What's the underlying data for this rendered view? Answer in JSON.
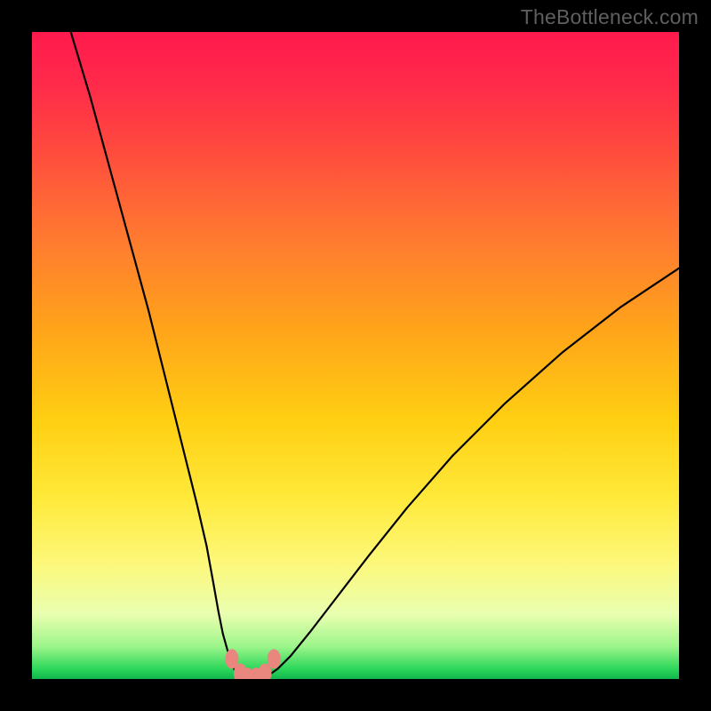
{
  "watermark": {
    "text": "TheBottleneck.com"
  },
  "chart_data": {
    "type": "line",
    "title": "",
    "xlabel": "",
    "ylabel": "",
    "xlim": [
      0,
      100
    ],
    "ylim": [
      0,
      100
    ],
    "grid": false,
    "legend": false,
    "series": [
      {
        "name": "bottleneck-curve",
        "x": [
          6,
          9,
          12,
          15,
          18,
          20,
          22,
          24,
          25.5,
          27,
          28,
          28.8,
          29.5,
          30.2,
          30.8,
          31.3,
          31.8
        ],
        "values": [
          100,
          90,
          79,
          68,
          57,
          49,
          41,
          33,
          27,
          20.5,
          15,
          10.5,
          7,
          4.5,
          2.7,
          1.4,
          0.6
        ]
      },
      {
        "name": "bottleneck-curve-min",
        "x": [
          31.8,
          32.3,
          32.9,
          33.6,
          34.4,
          35.4,
          36.6
        ],
        "values": [
          0.6,
          0.25,
          0.1,
          0.05,
          0.1,
          0.25,
          0.6
        ]
      },
      {
        "name": "bottleneck-curve-right",
        "x": [
          36.6,
          38,
          40,
          43,
          47,
          52,
          58,
          65,
          73,
          82,
          91,
          100
        ],
        "values": [
          0.6,
          1.6,
          3.6,
          7.3,
          12.5,
          19,
          26.5,
          34.5,
          42.5,
          50.5,
          57.5,
          63.5
        ]
      }
    ],
    "markers": {
      "name": "highlight-points",
      "x": [
        30.9,
        32.2,
        33.3,
        34.6,
        36.0,
        37.4
      ],
      "values": [
        3.1,
        0.9,
        0.25,
        0.25,
        0.9,
        3.1
      ]
    },
    "gradient_stops": [
      {
        "pos": 0.0,
        "color": "#ff1a4d"
      },
      {
        "pos": 0.32,
        "color": "#ff7a30"
      },
      {
        "pos": 0.6,
        "color": "#ffcf12"
      },
      {
        "pos": 0.82,
        "color": "#fdf87a"
      },
      {
        "pos": 0.95,
        "color": "#9cf58a"
      },
      {
        "pos": 1.0,
        "color": "#11b54e"
      }
    ]
  }
}
